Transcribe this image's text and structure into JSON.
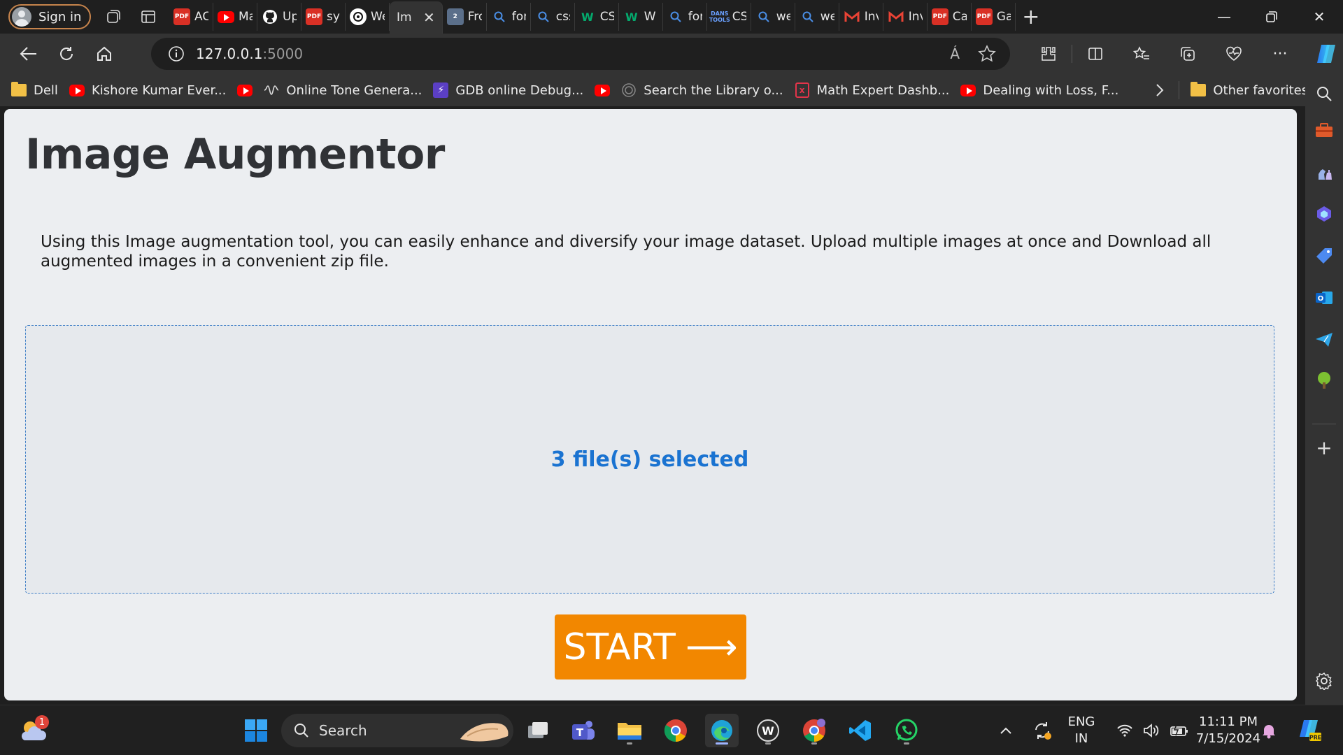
{
  "browser": {
    "profile_label": "Sign in",
    "tabs": [
      {
        "title": "AC",
        "icon": "pdf-icon"
      },
      {
        "title": "Ma",
        "icon": "youtube-icon"
      },
      {
        "title": "Up",
        "icon": "github-icon"
      },
      {
        "title": "syl",
        "icon": "pdf-icon"
      },
      {
        "title": "We",
        "icon": "chatgpt-icon"
      },
      {
        "title": "Im",
        "icon": "none",
        "active": true
      },
      {
        "title": "Fro",
        "icon": "number-2-icon"
      },
      {
        "title": "for",
        "icon": "search-icon"
      },
      {
        "title": "css",
        "icon": "search-icon"
      },
      {
        "title": "CS",
        "icon": "w3schools-icon"
      },
      {
        "title": "W",
        "icon": "w3schools-icon"
      },
      {
        "title": "for",
        "icon": "search-icon"
      },
      {
        "title": "CS",
        "icon": "css-tools-icon"
      },
      {
        "title": "we",
        "icon": "search-icon"
      },
      {
        "title": "we",
        "icon": "search-icon"
      },
      {
        "title": "Inv",
        "icon": "gmail-icon"
      },
      {
        "title": "Inv",
        "icon": "gmail-icon"
      },
      {
        "title": "Ca",
        "icon": "pdf-icon"
      },
      {
        "title": "Ga",
        "icon": "pdf-icon"
      }
    ],
    "css_tools_label": "DANS\nTOOLS",
    "address": {
      "host": "127.0.0.1",
      "port": ":5000"
    },
    "read_aloud_label": "Á",
    "favorites": [
      {
        "label": "Dell",
        "icon": "folder-icon"
      },
      {
        "label": "Kishore Kumar Ever...",
        "icon": "youtube-icon"
      },
      {
        "label": "",
        "icon": "youtube-icon"
      },
      {
        "label": "Online Tone Genera...",
        "icon": "waveform-icon"
      },
      {
        "label": "GDB online Debug...",
        "icon": "gdb-icon"
      },
      {
        "label": "",
        "icon": "youtube-icon"
      },
      {
        "label": "Search the Library o...",
        "icon": "library-icon"
      },
      {
        "label": "Math Expert Dashb...",
        "icon": "math-icon"
      },
      {
        "label": "Dealing with Loss, F...",
        "icon": "youtube-icon"
      }
    ],
    "other_favorites": "Other favorites"
  },
  "page": {
    "title": "Image Augmentor",
    "description": "Using this Image augmentation tool, you can easily enhance and diversify your image dataset. Upload multiple images at once and Download all augmented images in a convenient zip file.",
    "dropzone_text": "3 file(s) selected",
    "start_label": "START",
    "start_arrow": "⟶"
  },
  "taskbar": {
    "weather_badge": "1",
    "search_label": "Search",
    "language": "ENG",
    "region": "IN",
    "time": "11:11 PM",
    "date": "7/15/2024"
  },
  "colors": {
    "accent_orange": "#f28700",
    "dropzone_blue": "#1a73d1",
    "page_bg": "#eceef1"
  }
}
